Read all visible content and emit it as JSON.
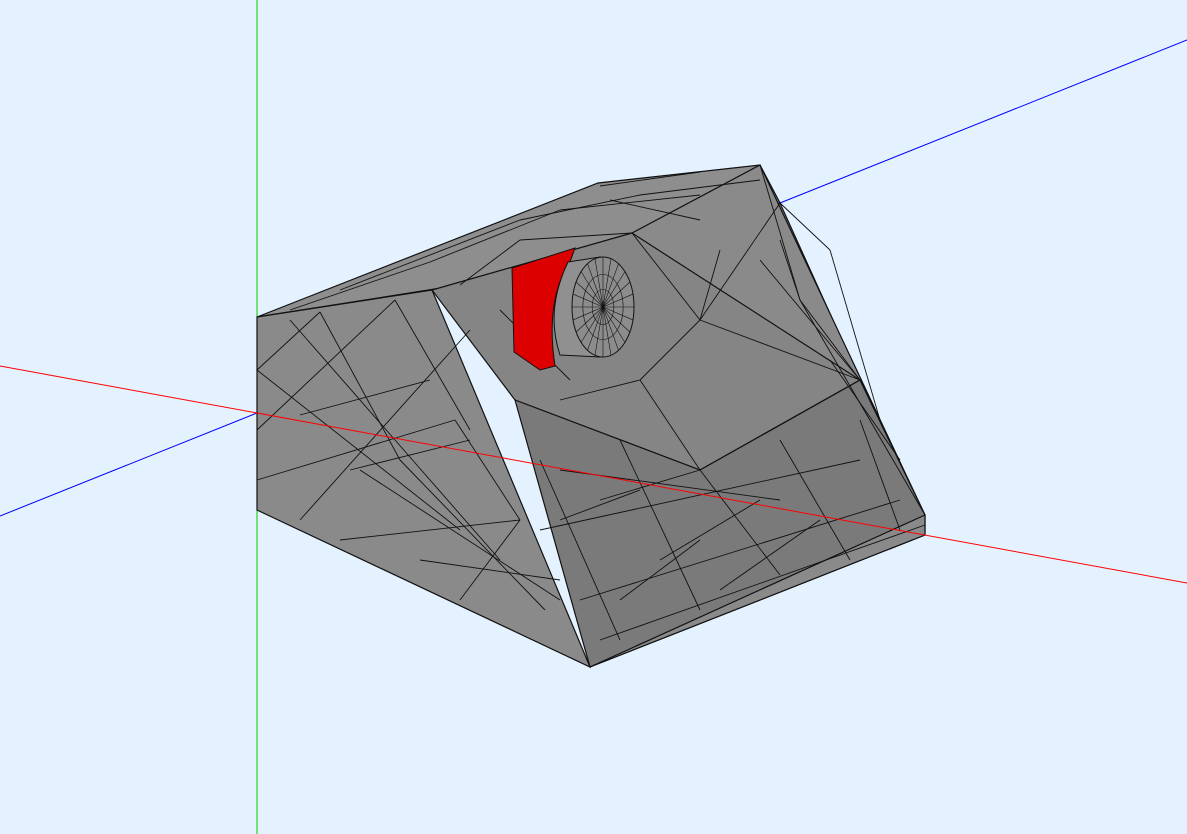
{
  "viewport": {
    "name": "3D mesh viewer",
    "background": "#e4f1fe"
  },
  "axes": {
    "x_color": "#ff0000",
    "y_color": "#00cc00",
    "z_color": "#0000ff"
  },
  "model": {
    "face_color": "#8a8a8a",
    "face_dark": "#7a7a7a",
    "face_light": "#969696",
    "edge_color": "#111111",
    "selected_face_color": "#e00000"
  }
}
